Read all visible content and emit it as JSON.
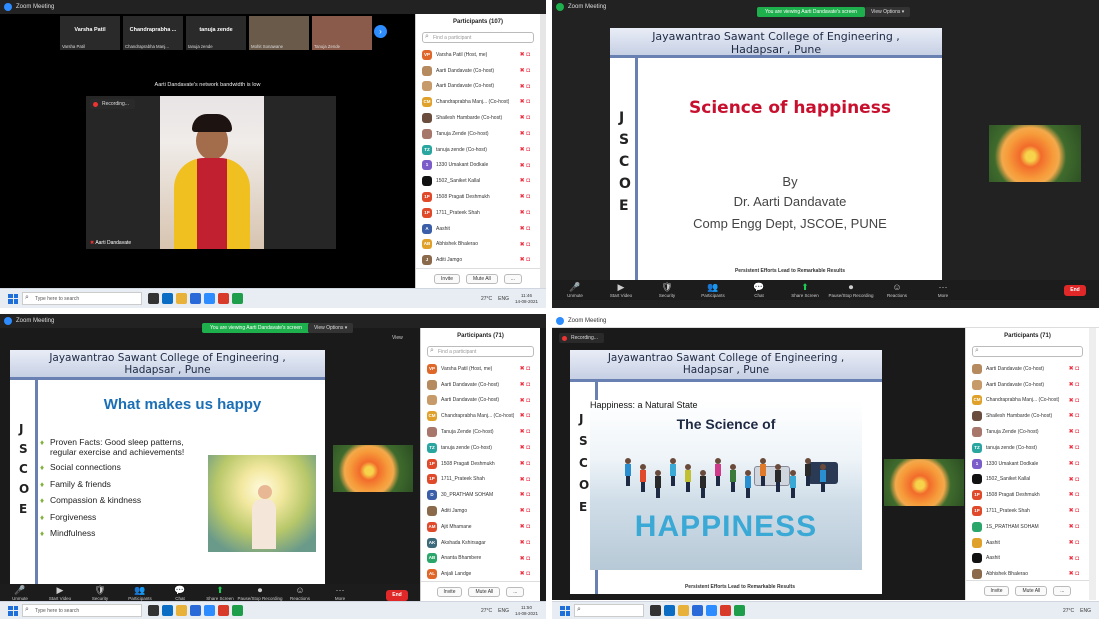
{
  "app": {
    "window_title": "Zoom Meeting"
  },
  "q1": {
    "gallery": [
      {
        "title": "Varsha Patil",
        "name": "Varsha Patil"
      },
      {
        "title": "Chandraprabha ...",
        "name": "Chandraprabha Manj..."
      },
      {
        "title": "tanuja zende",
        "name": "tanuja zende"
      },
      {
        "title": "",
        "name": "Mohit Sonawane"
      },
      {
        "title": "",
        "name": "Tanuja Zende"
      }
    ],
    "bandwidth_msg": "Aarti Dandavate's network bandwidth is low",
    "recording": "Recording...",
    "speaker_name": "Aarti Dandavate",
    "panel_title": "Participants (107)",
    "search_placeholder": "Find a participant",
    "participants": [
      {
        "initials": "VP",
        "color": "#e0672a",
        "name": "Varsha Patil (Host, me)"
      },
      {
        "initials": "",
        "color": "#b58a5f",
        "name": "Aarti Dandavate (Co-host)"
      },
      {
        "initials": "",
        "color": "#c79a6a",
        "name": "Aarti Dandavate (Co-host)"
      },
      {
        "initials": "CM",
        "color": "#e0a12a",
        "name": "Chandraprabha Manj... (Co-host)"
      },
      {
        "initials": "",
        "color": "#6b4d3d",
        "name": "Shailesh Hambarde (Co-host)"
      },
      {
        "initials": "",
        "color": "#a6776a",
        "name": "Tanuja Zende (Co-host)"
      },
      {
        "initials": "TZ",
        "color": "#2aa6a0",
        "name": "tanuja zende (Co-host)"
      },
      {
        "initials": "1",
        "color": "#7b5cc9",
        "name": "1330 Umakant Dodkale"
      },
      {
        "initials": "",
        "color": "#111111",
        "name": "1502_Saniket Kallal"
      },
      {
        "initials": "1P",
        "color": "#e04a2a",
        "name": "1508 Pragati Deshmukh"
      },
      {
        "initials": "1P",
        "color": "#e04a2a",
        "name": "1711_Prateek Shah"
      },
      {
        "initials": "A",
        "color": "#3b5ea8",
        "name": "Aashit"
      },
      {
        "initials": "AB",
        "color": "#e0a12a",
        "name": "Abhishek Bhalerao"
      },
      {
        "initials": "J",
        "color": "#8a6a4a",
        "name": "Aditi Jamgo"
      }
    ],
    "invite": "Invite",
    "mute_all": "Mute All",
    "more": "...",
    "taskbar_search": "Type here to search",
    "weather": "27°C",
    "lang": "ENG",
    "time": "11:46",
    "date": "14-08-2021"
  },
  "q2": {
    "banner": "You are viewing Aarti Dandavate's screen",
    "view_options": "View Options ▾",
    "college_line1": "Jayawantrao Sawant College of Engineering ,",
    "college_line2": "Hadapsar , Pune",
    "side_letters": [
      "J",
      "S",
      "C",
      "O",
      "E"
    ],
    "title": "Science of happiness",
    "by": "By",
    "author": "Dr. Aarti Dandavate",
    "dept": "Comp Engg Dept, JSCOE, PUNE",
    "footer": "Persistent Efforts Lead to Remarkable Results",
    "toolbar": [
      {
        "icon": "🎤",
        "label": "Unmute"
      },
      {
        "icon": "▶",
        "label": "Start Video"
      },
      {
        "icon": "🛡",
        "label": "Security"
      },
      {
        "icon": "👥",
        "label": "Participants"
      },
      {
        "icon": "💬",
        "label": "Chat"
      },
      {
        "icon": "⬆",
        "label": "Share Screen"
      },
      {
        "icon": "⏺",
        "label": "Pause/Stop Recording"
      },
      {
        "icon": "☺",
        "label": "Reactions"
      },
      {
        "icon": "···",
        "label": "More"
      }
    ],
    "end": "End"
  },
  "q3": {
    "banner": "You are viewing Aarti Dandavate's screen",
    "view_options": "View Options ▾",
    "view": "View",
    "college_line1": "Jayawantrao Sawant College of Engineering ,",
    "college_line2": "Hadapsar , Pune",
    "side_letters": [
      "J",
      "S",
      "C",
      "O",
      "E"
    ],
    "heading": "What makes us happy",
    "bullets": [
      "Proven Facts: Good sleep patterns, regular exercise and achievements!",
      "Social connections",
      "Family & friends",
      "Compassion & kindness",
      "Forgiveness",
      "Mindfulness"
    ],
    "panel_title": "Participants (71)",
    "search_placeholder": "Find a participant",
    "participants": [
      {
        "initials": "VP",
        "color": "#e0672a",
        "name": "Varsha Patil (Host, me)"
      },
      {
        "initials": "",
        "color": "#b58a5f",
        "name": "Aarti Dandavate (Co-host)"
      },
      {
        "initials": "",
        "color": "#c79a6a",
        "name": "Aarti Dandavate (Co-host)"
      },
      {
        "initials": "CM",
        "color": "#e0a12a",
        "name": "Chandraprabha Manj... (Co-host)"
      },
      {
        "initials": "",
        "color": "#a6776a",
        "name": "Tanuja Zende (Co-host)"
      },
      {
        "initials": "TZ",
        "color": "#2aa6a0",
        "name": "tanuja zende (Co-host)"
      },
      {
        "initials": "1P",
        "color": "#e04a2a",
        "name": "1508 Pragati Deshmukh"
      },
      {
        "initials": "1P",
        "color": "#e04a2a",
        "name": "1711_Prateek Shah"
      },
      {
        "initials": "D",
        "color": "#3b5ea8",
        "name": "30_PRATHAM SOHAM"
      },
      {
        "initials": "",
        "color": "#8a6a4a",
        "name": "Aditi Jamgo"
      },
      {
        "initials": "AM",
        "color": "#e04a2a",
        "name": "Ajit Mhamane"
      },
      {
        "initials": "AK",
        "color": "#3d6a7a",
        "name": "Akshada Kshirsagar"
      },
      {
        "initials": "AB",
        "color": "#2aa66a",
        "name": "Ananta Bhambere"
      },
      {
        "initials": "AL",
        "color": "#e0672a",
        "name": "Anjali Landge"
      }
    ],
    "invite": "Invite",
    "mute_all": "Mute All",
    "more": "...",
    "toolbar": [
      {
        "icon": "🎤",
        "label": "Unmute"
      },
      {
        "icon": "▶",
        "label": "Start Video"
      },
      {
        "icon": "🛡",
        "label": "Security"
      },
      {
        "icon": "👥",
        "label": "Participants"
      },
      {
        "icon": "💬",
        "label": "Chat"
      },
      {
        "icon": "⬆",
        "label": "Share Screen"
      },
      {
        "icon": "⏺",
        "label": "Pause/Stop Recording"
      },
      {
        "icon": "☺",
        "label": "Reactions"
      },
      {
        "icon": "···",
        "label": "More"
      }
    ],
    "end": "End",
    "taskbar_search": "Type here to search",
    "weather": "27°C",
    "lang": "ENG",
    "time": "11:50",
    "date": "14-08-2021"
  },
  "q4": {
    "recording": "Recording...",
    "college_line1": "Jayawantrao Sawant College of Engineering ,",
    "college_line2": "Hadapsar , Pune",
    "side_letters": [
      "J",
      "S",
      "C",
      "O",
      "E"
    ],
    "caption": "Happiness: a Natural State",
    "img_title": "The Science of",
    "img_word": "HAPPINESS",
    "footer": "Persistent Efforts Lead to Remarkable Results",
    "panel_title": "Participants (71)",
    "participants": [
      {
        "initials": "",
        "color": "#b58a5f",
        "name": "Aarti Dandavate (Co-host)"
      },
      {
        "initials": "",
        "color": "#c79a6a",
        "name": "Aarti Dandavate (Co-host)"
      },
      {
        "initials": "CM",
        "color": "#e0a12a",
        "name": "Chandraprabha Manj... (Co-host)"
      },
      {
        "initials": "",
        "color": "#6b4d3d",
        "name": "Shailesh Hambarde (Co-host)"
      },
      {
        "initials": "",
        "color": "#a6776a",
        "name": "Tanuja Zende (Co-host)"
      },
      {
        "initials": "TZ",
        "color": "#2aa6a0",
        "name": "tanuja zende (Co-host)"
      },
      {
        "initials": "1",
        "color": "#7b5cc9",
        "name": "1330 Umakant Dodkale"
      },
      {
        "initials": "",
        "color": "#111111",
        "name": "1502_Saniket Kallal"
      },
      {
        "initials": "1P",
        "color": "#e04a2a",
        "name": "1508 Pragati Deshmukh"
      },
      {
        "initials": "1P",
        "color": "#e04a2a",
        "name": "1711_Prateek Shah"
      },
      {
        "initials": "",
        "color": "#2aa66a",
        "name": "1S_PRATHAM SOHAM"
      },
      {
        "initials": "",
        "color": "#e0a12a",
        "name": "Aashit"
      },
      {
        "initials": "",
        "color": "#111111",
        "name": "Aashit"
      },
      {
        "initials": "",
        "color": "#8a6a4a",
        "name": "Abhishek Bhalerao"
      }
    ],
    "invite": "Invite",
    "mute_all": "Mute All",
    "more": "...",
    "weather": "27°C",
    "lang": "ENG"
  }
}
